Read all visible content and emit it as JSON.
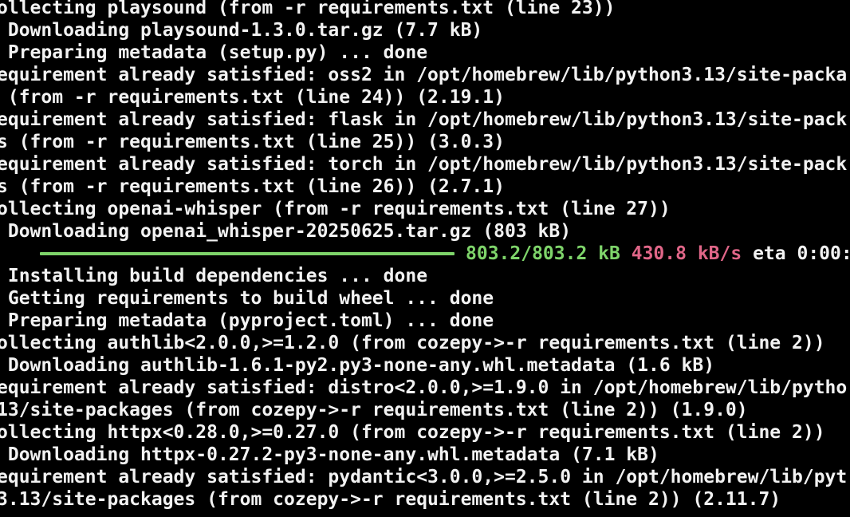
{
  "colors": {
    "background": "#000000",
    "text": "#f2f2f2",
    "progress_bar": "#7ed46a",
    "progress_size": "#7ed46a",
    "progress_rate": "#e06688"
  },
  "terminal": {
    "lines": [
      "ollecting playsound (from -r requirements.txt (line 23))",
      " Downloading playsound-1.3.0.tar.gz (7.7 kB)",
      " Preparing metadata (setup.py) ... done",
      "equirement already satisfied: oss2 in /opt/homebrew/lib/python3.13/site-packa",
      " (from -r requirements.txt (line 24)) (2.19.1)",
      "equirement already satisfied: flask in /opt/homebrew/lib/python3.13/site-pack",
      "s (from -r requirements.txt (line 25)) (3.0.3)",
      "equirement already satisfied: torch in /opt/homebrew/lib/python3.13/site-pack",
      "s (from -r requirements.txt (line 26)) (2.7.1)",
      "ollecting openai-whisper (from -r requirements.txt (line 27))",
      " Downloading openai_whisper-20250625.tar.gz (803 kB)"
    ],
    "progress": {
      "fraction": 1.0,
      "size": "803.2/803.2 kB",
      "rate": "430.8 kB/s",
      "eta": "eta 0:00:"
    },
    "lines_after": [
      " Installing build dependencies ... done",
      " Getting requirements to build wheel ... done",
      " Preparing metadata (pyproject.toml) ... done",
      "ollecting authlib<2.0.0,>=1.2.0 (from cozepy->-r requirements.txt (line 2))",
      " Downloading authlib-1.6.1-py2.py3-none-any.whl.metadata (1.6 kB)",
      "equirement already satisfied: distro<2.0.0,>=1.9.0 in /opt/homebrew/lib/pytho",
      "13/site-packages (from cozepy->-r requirements.txt (line 2)) (1.9.0)",
      "ollecting httpx<0.28.0,>=0.27.0 (from cozepy->-r requirements.txt (line 2))",
      " Downloading httpx-0.27.2-py3-none-any.whl.metadata (7.1 kB)",
      "equirement already satisfied: pydantic<3.0.0,>=2.5.0 in /opt/homebrew/lib/pyt",
      "3.13/site-packages (from cozepy->-r requirements.txt (line 2)) (2.11.7)"
    ]
  }
}
